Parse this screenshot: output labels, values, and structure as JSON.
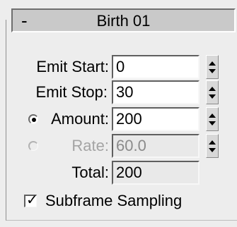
{
  "rollout": {
    "toggle": "-",
    "title": "Birth 01"
  },
  "fields": {
    "emit_start": {
      "label": "Emit Start:",
      "value": "0"
    },
    "emit_stop": {
      "label": "Emit Stop:",
      "value": "30"
    },
    "amount": {
      "label": "Amount:",
      "value": "200",
      "selected": true
    },
    "rate": {
      "label": "Rate:",
      "value": "60.0",
      "enabled": false
    },
    "total": {
      "label": "Total:",
      "value": "200"
    }
  },
  "subframe_sampling": {
    "label": "Subframe Sampling",
    "checked": true,
    "check_glyph": "✓"
  }
}
